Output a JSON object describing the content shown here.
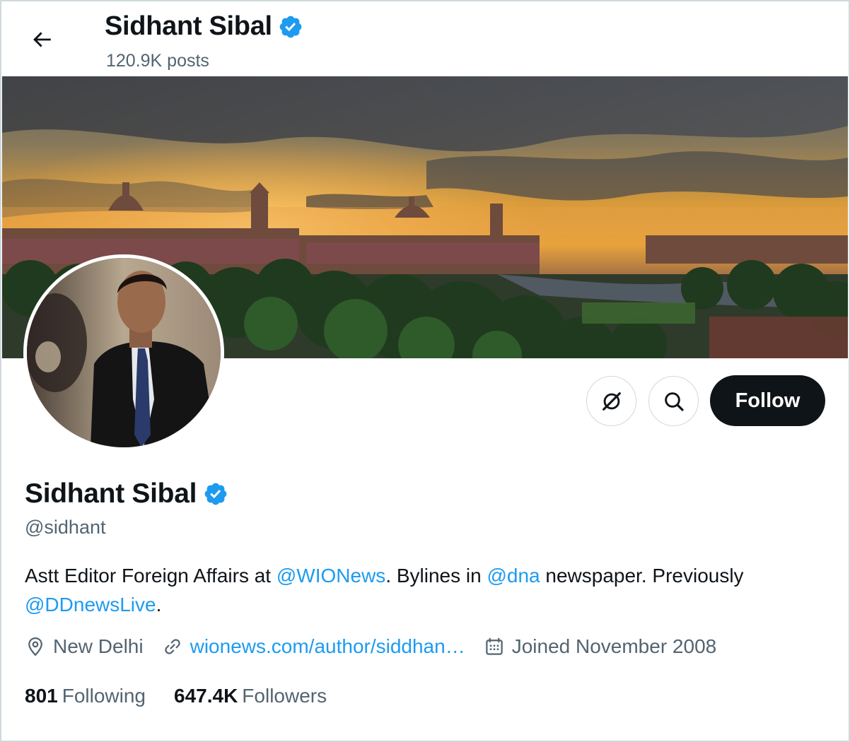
{
  "header": {
    "name": "Sidhant Sibal",
    "posts": "120.9K posts"
  },
  "actions": {
    "follow_label": "Follow"
  },
  "profile": {
    "name": "Sidhant Sibal",
    "handle": "@sidhant",
    "bio": {
      "text1": "Astt Editor Foreign Affairs at ",
      "mention1": "@WIONews",
      "text2": ". Bylines in ",
      "mention2": "@dna",
      "text3": " newspaper. Previously ",
      "mention3": "@DDnewsLive",
      "text4": "."
    },
    "location": "New Delhi",
    "website": "wionews.com/author/siddhan…",
    "joined": "Joined November 2008",
    "following_count": "801",
    "following_label": "Following",
    "followers_count": "647.4K",
    "followers_label": "Followers"
  },
  "colors": {
    "accent": "#1d9bf0",
    "text": "#0f1419",
    "secondary": "#536471",
    "verified": "#1d9bf0"
  },
  "icons": [
    "back-arrow-icon",
    "verified-badge-icon",
    "grok-icon",
    "search-icon",
    "location-icon",
    "link-icon",
    "calendar-icon"
  ]
}
